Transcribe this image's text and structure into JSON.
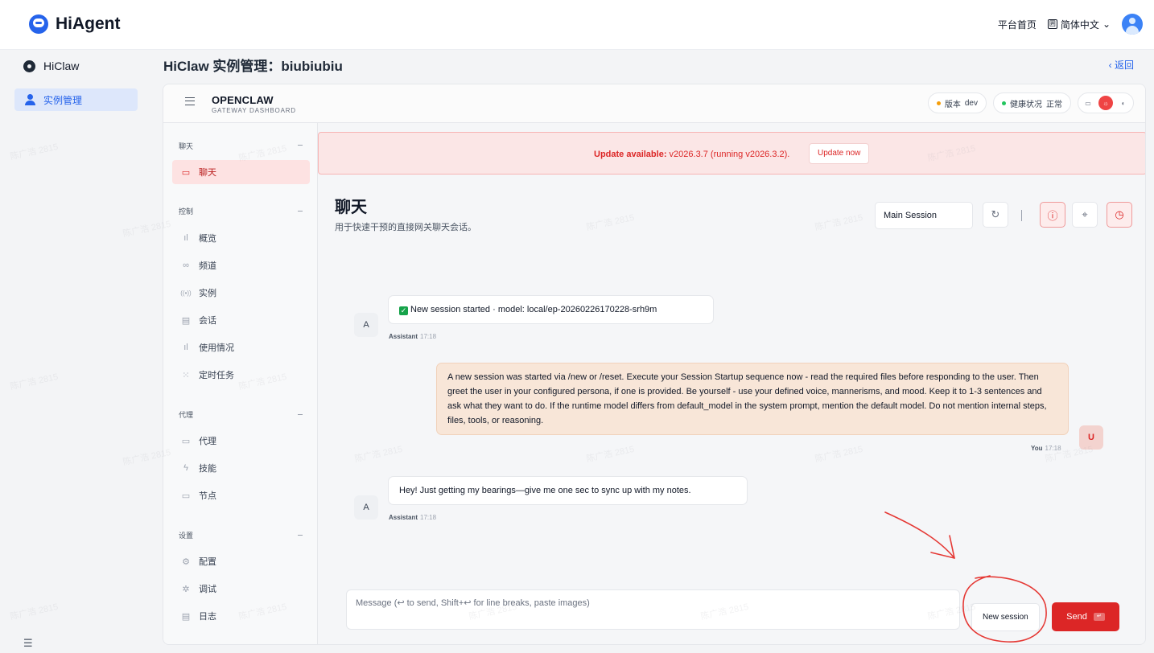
{
  "topbar": {
    "brand": "HiAgent",
    "platform_home": "平台首页",
    "lang_icon": "囲",
    "language": "简体中文",
    "chevron": "⌄"
  },
  "leftnav": {
    "app_name": "HiClaw",
    "active_item": "实例管理",
    "collapse_icon": "☰"
  },
  "page": {
    "title": "HiClaw 实例管理：biubiubiu",
    "back": "返回",
    "back_chevron": "‹"
  },
  "dashboard": {
    "title": "OPENCLAW",
    "subtitle": "GATEWAY DASHBOARD",
    "version_label": "版本",
    "version_value": "dev",
    "health_label": "健康状况",
    "health_value": "正常",
    "status_colors": {
      "version": "#f59e0b",
      "health": "#22c55e"
    },
    "theme_icons": [
      "▭",
      "☼",
      "◐"
    ]
  },
  "sidebar": {
    "sections": [
      {
        "label": "聊天",
        "items": [
          {
            "label": "聊天",
            "icon": "chat-icon",
            "glyph": "▭",
            "active": true
          }
        ]
      },
      {
        "label": "控制",
        "items": [
          {
            "label": "概览",
            "icon": "bar-chart-icon",
            "glyph": "ıl"
          },
          {
            "label": "频道",
            "icon": "link-icon",
            "glyph": "∞"
          },
          {
            "label": "实例",
            "icon": "broadcast-icon",
            "glyph": "((•))"
          },
          {
            "label": "会话",
            "icon": "document-icon",
            "glyph": "▤"
          },
          {
            "label": "使用情况",
            "icon": "bar-chart-icon",
            "glyph": "ıl"
          },
          {
            "label": "定时任务",
            "icon": "loader-icon",
            "glyph": "⁙"
          }
        ]
      },
      {
        "label": "代理",
        "items": [
          {
            "label": "代理",
            "icon": "folder-icon",
            "glyph": "▭"
          },
          {
            "label": "技能",
            "icon": "lightning-icon",
            "glyph": "ϟ"
          },
          {
            "label": "节点",
            "icon": "monitor-icon",
            "glyph": "▭"
          }
        ]
      },
      {
        "label": "设置",
        "items": [
          {
            "label": "配置",
            "icon": "settings-icon",
            "glyph": "⚙"
          },
          {
            "label": "调试",
            "icon": "bug-icon",
            "glyph": "✲"
          },
          {
            "label": "日志",
            "icon": "log-icon",
            "glyph": "▤"
          }
        ]
      }
    ]
  },
  "banner": {
    "prefix": "Update available:",
    "text": " v2026.3.7 (running v2026.3.2).",
    "button": "Update now"
  },
  "chat": {
    "title": "聊天",
    "subtitle": "用于快速干预的直接网关聊天会话。",
    "session": "Main Session",
    "tool_icons": [
      "↻",
      "ⓘ",
      "⌖",
      "◷"
    ],
    "messages": [
      {
        "role": "assistant",
        "avatar": "A",
        "check": "✓",
        "text": "New session started · model: local/ep-20260226170228-srh9m",
        "sender": "Assistant",
        "time": "17:18"
      },
      {
        "role": "user",
        "avatar": "U",
        "text": "A new session was started via /new or /reset. Execute your Session Startup sequence now - read the required files before responding to the user. Then greet the user in your configured persona, if one is provided. Be yourself - use your defined voice, mannerisms, and mood. Keep it to 1-3 sentences and ask what they want to do. If the runtime model differs from default_model in the system prompt, mention the default model. Do not mention internal steps, files, tools, or reasoning.",
        "sender": "You",
        "time": "17:18"
      },
      {
        "role": "assistant",
        "avatar": "A",
        "text": "Hey! Just getting my bearings—give me one sec to sync up with my notes.",
        "sender": "Assistant",
        "time": "17:18"
      }
    ],
    "composer_placeholder": "Message (↩ to send, Shift+↩ for line breaks, paste images)",
    "new_session": "New session",
    "send": "Send",
    "send_key": "↵"
  },
  "watermark": "陈广浩 2815",
  "annotation_color": "#e53935"
}
